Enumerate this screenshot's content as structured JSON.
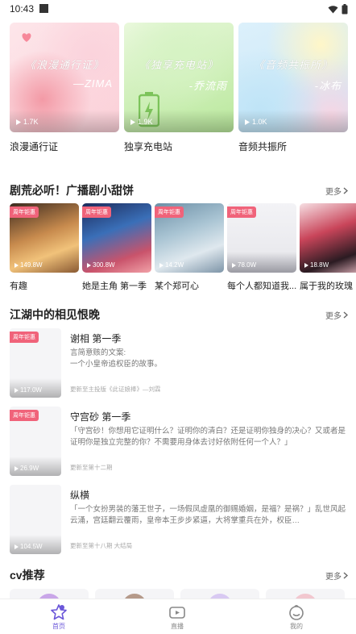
{
  "status_bar": {
    "time": "10:43"
  },
  "featured": [
    {
      "label": "浪漫通行证",
      "cover_title": "《浪漫通行证》",
      "cover_sub": "—ZIMA",
      "count": "1.7K"
    },
    {
      "label": "独享充电站",
      "cover_title": "《独享充电站》",
      "cover_sub": "-乔流雨",
      "count": "1.9K"
    },
    {
      "label": "音频共振所",
      "cover_title": "《音频共振所》",
      "cover_sub": "-冰布",
      "count": "1.0K"
    }
  ],
  "section1": {
    "title": "剧荒必听！广播剧小甜饼",
    "more": "更多",
    "items": [
      {
        "label": "有趣",
        "tag": "周年钜惠",
        "count": "149.8W"
      },
      {
        "label": "她是主角 第一季",
        "tag": "周年钜惠",
        "count": "300.8W"
      },
      {
        "label": "某个郑可心",
        "tag": "周年钜惠",
        "count": "14.2W"
      },
      {
        "label": "每个人都知道我...",
        "tag": "周年钜惠",
        "count": "78.0W"
      },
      {
        "label": "属于我的玫瑰",
        "tag": "",
        "count": "18.8W"
      }
    ]
  },
  "section2": {
    "title": "江湖中的相见恨晚",
    "more": "更多",
    "items": [
      {
        "title": "谢相 第一季",
        "tag": "周年钜惠",
        "count": "117.0W",
        "desc": "言简意赅的文案:\n一个小皇帝追权臣的故事。",
        "update": "更新至主投版《此证娘棒》—刘霖"
      },
      {
        "title": "守宫砂 第一季",
        "tag": "周年钜惠",
        "count": "26.9W",
        "desc": "「守宫砂！你想用它证明什么？证明你的清白？还是证明你独身的决心？又或者是证明你是独立完整的你？不需要用身体去讨好依附任何一个人？」",
        "update": "更新至第十二期"
      },
      {
        "title": "纵横",
        "tag": "",
        "count": "104.5W",
        "desc": "「一个女扮男装的藩王世子，一场假凤虚凰的御赐婚姻，是福？是祸？」乱世风起云涌，宫廷翻云覆雨，皇帝本王步步紧逼，大将掌重兵在外，权臣…",
        "update": "更新至第十八期 大结局"
      }
    ]
  },
  "section3": {
    "title": "cv推荐",
    "more": "更多"
  },
  "bottom_nav": [
    {
      "label": "首页",
      "icon": "home-star-icon",
      "active": true
    },
    {
      "label": "直播",
      "icon": "live-tv-icon",
      "active": false
    },
    {
      "label": "我的",
      "icon": "profile-face-icon",
      "active": false
    }
  ],
  "colors": {
    "accent": "#6b57d9",
    "tag": "#f0637a"
  }
}
